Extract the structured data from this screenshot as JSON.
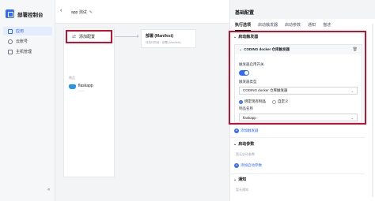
{
  "sidebar": {
    "title": "部署控制台",
    "items": [
      {
        "label": "应用",
        "active": true
      },
      {
        "label": "云账号",
        "active": false
      },
      {
        "label": "主机管理",
        "active": false
      }
    ],
    "collapse_icon": "«"
  },
  "topbar": {
    "back_icon": "‹",
    "app_name": "app 测试",
    "edit_icon": "✎"
  },
  "canvas": {
    "trigger_label": "添加配置",
    "trigger_icon": "⇄",
    "artifact_section": "制品",
    "artifact_name": "flaskapp",
    "artifact_sub": "——",
    "deploy_title": "部署 (Manifest)",
    "deploy_sub": "待执行阶段：部署 (Manifest)"
  },
  "panel": {
    "title": "基础配置",
    "tabs": [
      "执行选项",
      "启动触发器",
      "启动参数",
      "通知",
      "描述"
    ],
    "active_tab": 0,
    "trigger_section": "启动触发器",
    "trigger_card_title": "CODING docker 仓库触发器",
    "enable_label": "触发器启用开关",
    "type_label": "触发器类型",
    "type_value": "CODING docker 仓库触发器",
    "radio_bound": "绑定现有制品",
    "radio_custom": "自定义",
    "artifact_label": "制品名称",
    "artifact_value": "flaskapp",
    "add_trigger": "添加触发器",
    "params_section": "启动参数",
    "params_empty": "暂无启动参数",
    "add_params": "添加启动参数",
    "notify_section": "通知",
    "notify_empty": "暂无通知"
  },
  "colors": {
    "accent": "#2f6bff",
    "highlight": "#c8102e"
  }
}
